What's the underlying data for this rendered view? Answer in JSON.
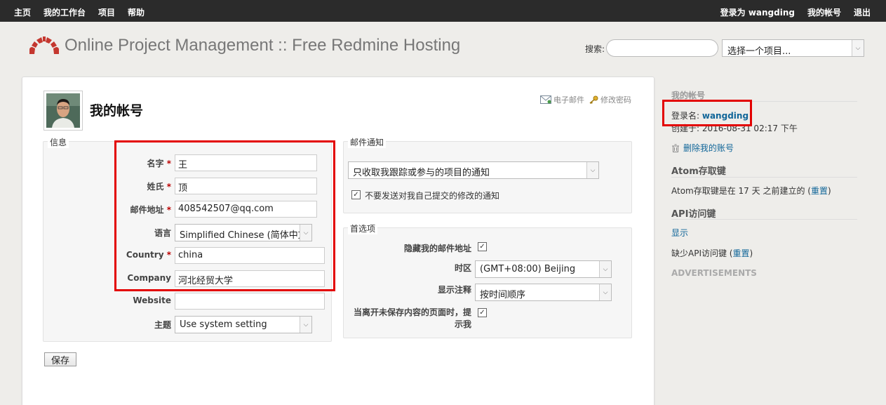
{
  "top_menu": {
    "items": [
      "主页",
      "我的工作台",
      "项目",
      "帮助"
    ],
    "login_prefix": "登录为",
    "login_user": "wangding",
    "my_account": "我的帐号",
    "logout": "退出"
  },
  "header": {
    "title": "Online Project Management :: Free Redmine Hosting",
    "search_label": "搜索:",
    "search_value": "",
    "project_select": "选择一个项目..."
  },
  "content": {
    "page_title": "我的帐号",
    "contextual_email": "电子邮件",
    "contextual_password": "修改密码",
    "info_legend": "信息",
    "fields": [
      {
        "label": "名字",
        "required": "*",
        "value": "王"
      },
      {
        "label": "姓氏",
        "required": "*",
        "value": "顶"
      },
      {
        "label": "邮件地址",
        "required": "*",
        "value": "408542507@qq.com"
      },
      {
        "label": "语言",
        "required": "",
        "value": "Simplified Chinese (简体中文"
      },
      {
        "label": "Country",
        "required": "*",
        "value": "china"
      },
      {
        "label": "Company",
        "required": "",
        "value": "河北经贸大学"
      },
      {
        "label": "Website",
        "required": "",
        "value": ""
      },
      {
        "label": "主题",
        "required": "",
        "value": "Use system setting"
      }
    ],
    "mail_legend": "邮件通知",
    "mail_select": "只收取我跟踪或参与的项目的通知",
    "mail_no_self": "不要发送对我自己提交的修改的通知",
    "prefs_legend": "首选项",
    "pref_hide_mail": "隐藏我的邮件地址",
    "pref_timezone_label": "时区",
    "pref_timezone": "(GMT+08:00) Beijing",
    "pref_comments_label": "显示注释",
    "pref_comments": "按时间顺序",
    "pref_warn_line1": "当离开未保存内容的页面时，提",
    "pref_warn_line2": "示我",
    "save": "保存"
  },
  "sidebar": {
    "my_account_head": "我的帐号",
    "login_label": "登录名:",
    "login_value": "wangding",
    "created_label": "创建于:",
    "created_value": "2016-08-31 02:17 下午",
    "delete_account": "删除我的账号",
    "atom_head": "Atom存取键",
    "atom_text": "Atom存取键是在 17 天 之前建立的 (",
    "atom_reset": "重置",
    "api_head": "API访问键",
    "api_show": "显示",
    "api_text": "缺少API访问键 (",
    "api_reset": "重置",
    "ads": "ADVERTISEMENTS",
    "paren_close": ")"
  },
  "colors": {
    "highlight": "#e30000",
    "topbar": "#2b2b2b",
    "link": "#116699"
  }
}
